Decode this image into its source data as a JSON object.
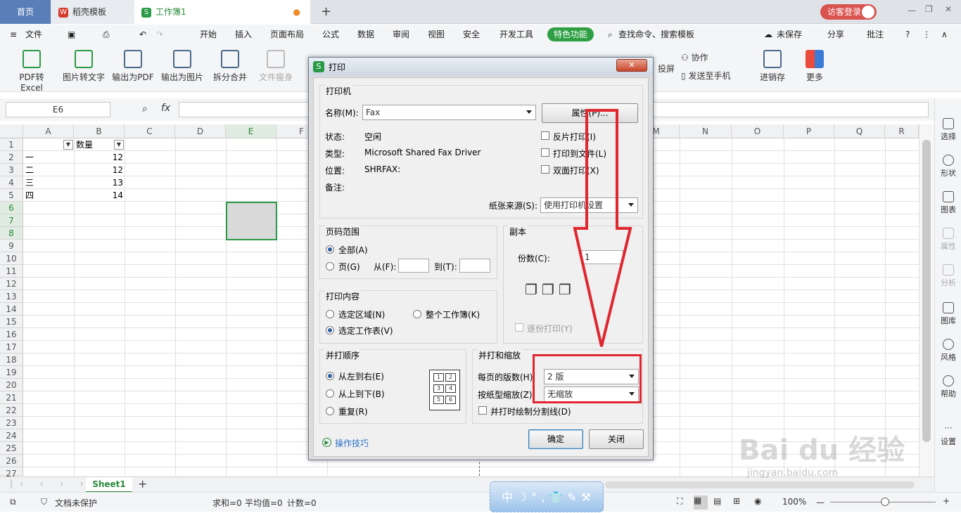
{
  "tabs": {
    "home": "首页",
    "template": "稻壳模板",
    "workbook": "工作簿1"
  },
  "login": "访客登录",
  "menu": {
    "file": "文件",
    "items": [
      "开始",
      "插入",
      "页面布局",
      "公式",
      "数据",
      "审阅",
      "视图",
      "安全",
      "开发工具"
    ],
    "special": "特色功能",
    "search": "查找命令、搜索模板",
    "unsaved": "未保存",
    "share": "分享",
    "comment": "批注"
  },
  "ribbon": {
    "items": [
      "PDF转Excel",
      "图片转文字",
      "输出为PDF",
      "输出为图片",
      "拆分合并",
      "文件瘦身"
    ],
    "right": [
      "投屏",
      "协作",
      "发送至手机",
      "进销存",
      "更多"
    ]
  },
  "formula": {
    "cell_ref": "E6",
    "fx": "fx"
  },
  "columns": [
    "A",
    "B",
    "C",
    "D",
    "E",
    "F",
    "M",
    "N",
    "O",
    "P",
    "Q",
    "R"
  ],
  "rows": [
    "1",
    "2",
    "3",
    "4",
    "5",
    "6",
    "7",
    "8",
    "9",
    "10",
    "11",
    "12",
    "13",
    "14",
    "15",
    "16",
    "17",
    "18",
    "19",
    "20",
    "21",
    "22",
    "23",
    "24",
    "25",
    "26",
    "27"
  ],
  "cells": {
    "b1": "数量",
    "a2": "一",
    "b2": "12",
    "a3": "二",
    "b3": "12",
    "a4": "三",
    "b4": "13",
    "a5": "四",
    "b5": "14"
  },
  "right_panel": [
    "选择",
    "形状",
    "图表",
    "属性",
    "分析",
    "图库",
    "风格",
    "帮助",
    "设置"
  ],
  "sheet": {
    "name": "Sheet1",
    "add": "+"
  },
  "status": {
    "protect": "文档未保护",
    "sum": "求和=0",
    "avg": "平均值=0",
    "count": "计数=0",
    "zoom": "100%"
  },
  "dialog": {
    "title": "打印",
    "printer_group": "打印机",
    "name_label": "名称(M):",
    "name_value": "Fax",
    "props_btn": "属性(P)...",
    "state_label": "状态:",
    "state_value": "空闲",
    "type_label": "类型:",
    "type_value": "Microsoft Shared Fax Driver",
    "loc_label": "位置:",
    "loc_value": "SHRFAX:",
    "note_label": "备注:",
    "reverse": "反片打印(I)",
    "to_file": "打印到文件(L)",
    "duplex": "双面打印(X)",
    "source_label": "纸张来源(S):",
    "source_value": "使用打印机设置",
    "range_group": "页码范围",
    "all": "全部(A)",
    "pages": "页(G)",
    "from": "从(F):",
    "to": "到(T):",
    "copies_group": "副本",
    "copies_label": "份数(C):",
    "copies_value": "1",
    "collate": "逐份打印(Y)",
    "content_group": "打印内容",
    "sel_area": "选定区域(N)",
    "whole_book": "整个工作簿(K)",
    "sel_sheet": "选定工作表(V)",
    "order_group": "并打顺序",
    "ltr": "从左到右(E)",
    "ttb": "从上到下(B)",
    "repeat": "重复(R)",
    "order_nums": [
      "1",
      "2",
      "3",
      "4",
      "5",
      "6"
    ],
    "scale_group": "并打和缩放",
    "per_page_label": "每页的版数(H):",
    "per_page_value": "2 版",
    "scale_label": "按纸型缩放(Z):",
    "scale_value": "无缩放",
    "divider": "并打时绘制分割线(D)",
    "tips": "操作技巧",
    "ok": "确定",
    "close": "关闭"
  },
  "watermark": {
    "brand": "Bai du 经验",
    "url": "jingyan.baidu.com"
  }
}
